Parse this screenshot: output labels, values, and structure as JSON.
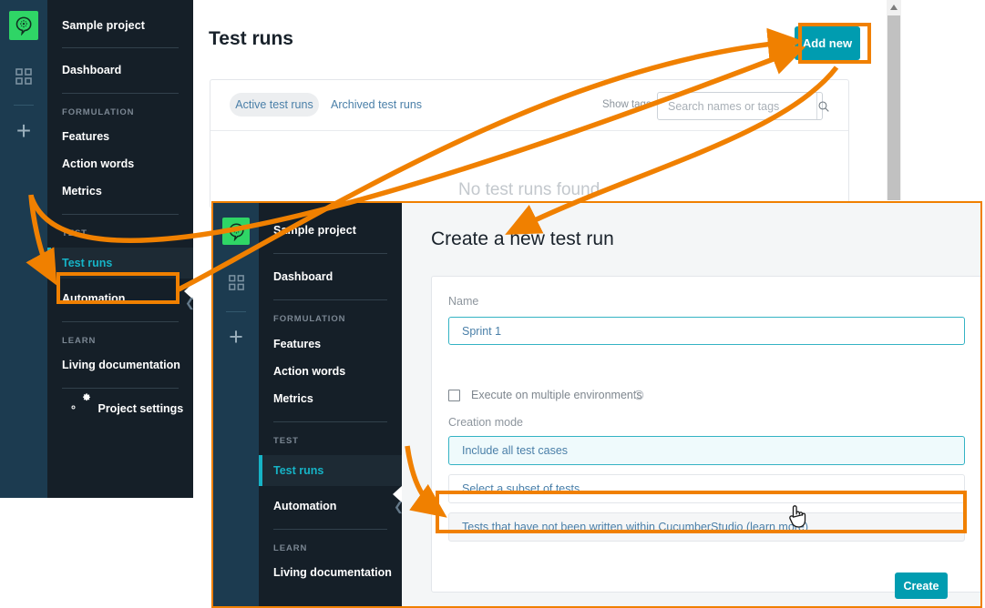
{
  "accent": {
    "teal": "#009cb0",
    "nav_active": "#16b3c6",
    "annotation_orange": "#f08000",
    "logo_green": "#2fd566",
    "nav_bg": "#151f28",
    "rail_bg": "#1c3b50"
  },
  "sidebar": {
    "project": "Sample project",
    "dashboard": "Dashboard",
    "sections": [
      {
        "title": "FORMULATION",
        "items": [
          "Features",
          "Action words",
          "Metrics"
        ]
      },
      {
        "title": "TEST",
        "items": [
          "Test runs",
          "Automation"
        ]
      },
      {
        "title": "LEARN",
        "items": [
          "Living documentation"
        ]
      }
    ],
    "settings": "Project settings",
    "active_item": "Test runs",
    "icons": {
      "logo": "cucumber-logo-icon",
      "grid": "grid-apps-icon",
      "plus": "add-project-icon",
      "gear": "gear-icon",
      "collapse": "collapse-chevron-icon"
    }
  },
  "main": {
    "title": "Test runs",
    "add_new": "Add new",
    "tabs": [
      {
        "label": "Active test runs",
        "active": true
      },
      {
        "label": "Archived test runs",
        "active": false
      }
    ],
    "show_tags": "Show tags",
    "search_placeholder": "Search names or tags",
    "search_value": "",
    "search_icon": "search-icon",
    "empty_message": "No test runs found",
    "scrollbar_up_icon": "scroll-up-arrow-icon"
  },
  "modal": {
    "title": "Create a new test run",
    "name_label": "Name",
    "name_value": "Sprint 1",
    "checkbox_label": "Execute on multiple environments",
    "checkbox_checked": false,
    "info_icon": "info-circle-icon",
    "creation_mode_label": "Creation mode",
    "options": [
      {
        "label": "Include all test cases",
        "state": "selected"
      },
      {
        "label": "Select a subset of tests",
        "state": "default"
      },
      {
        "label": "Tests that have not been written within CucumberStudio (learn more)",
        "state": "hovered"
      }
    ],
    "create_button": "Create",
    "cursor_icon": "pointing-hand-cursor-icon"
  },
  "annotations": {
    "highlight_add_new": "Add new",
    "highlight_test_runs": "Test runs",
    "highlight_option_3": "Tests that have not been written within CucumberStudio (learn more)",
    "arrow_color": "#f08000"
  }
}
